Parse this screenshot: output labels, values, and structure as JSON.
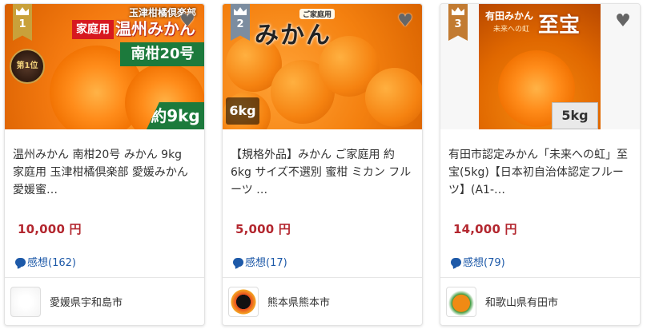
{
  "products": [
    {
      "rank": "1",
      "image_text": {
        "top": "玉津柑橘倶楽部",
        "red": "家庭用",
        "white": "温州みかん",
        "green": "南柑20号",
        "weight": "約9kg",
        "badge": "第1位"
      },
      "name": "温州みかん 南柑20号 みかん 9kg 家庭用 玉津柑橘倶楽部 愛媛みかん 愛媛蜜…",
      "price": "10,000 円",
      "reviews": "感想(162)",
      "city": "愛媛県宇和島市"
    },
    {
      "rank": "2",
      "image_text": {
        "sub": "ご家庭用",
        "title": "みかん",
        "weight": "6kg"
      },
      "name": "【規格外品】みかん ご家庭用 約6kg サイズ不選別 蜜柑 ミカン フルーツ …",
      "price": "5,000 円",
      "reviews": "感想(17)",
      "city": "熊本県熊本市"
    },
    {
      "rank": "3",
      "image_text": {
        "brand": "有田みかん",
        "tagline": "未来への虹",
        "big": "至宝",
        "box": "5kg"
      },
      "name": "有田市認定みかん「未来への虹」至宝(5kg)【日本初自治体認定フルーツ】(A1-…",
      "price": "14,000 円",
      "reviews": "感想(79)",
      "city": "和歌山県有田市"
    }
  ],
  "colors": {
    "price": "#b3272f",
    "review": "#1d59a8",
    "rank_gold": "#c9a13a",
    "rank_silver": "#7c8da0",
    "rank_bronze": "#c27b32"
  },
  "icons": [
    "crown-icon",
    "heart-icon",
    "chat-bubble-icon"
  ]
}
